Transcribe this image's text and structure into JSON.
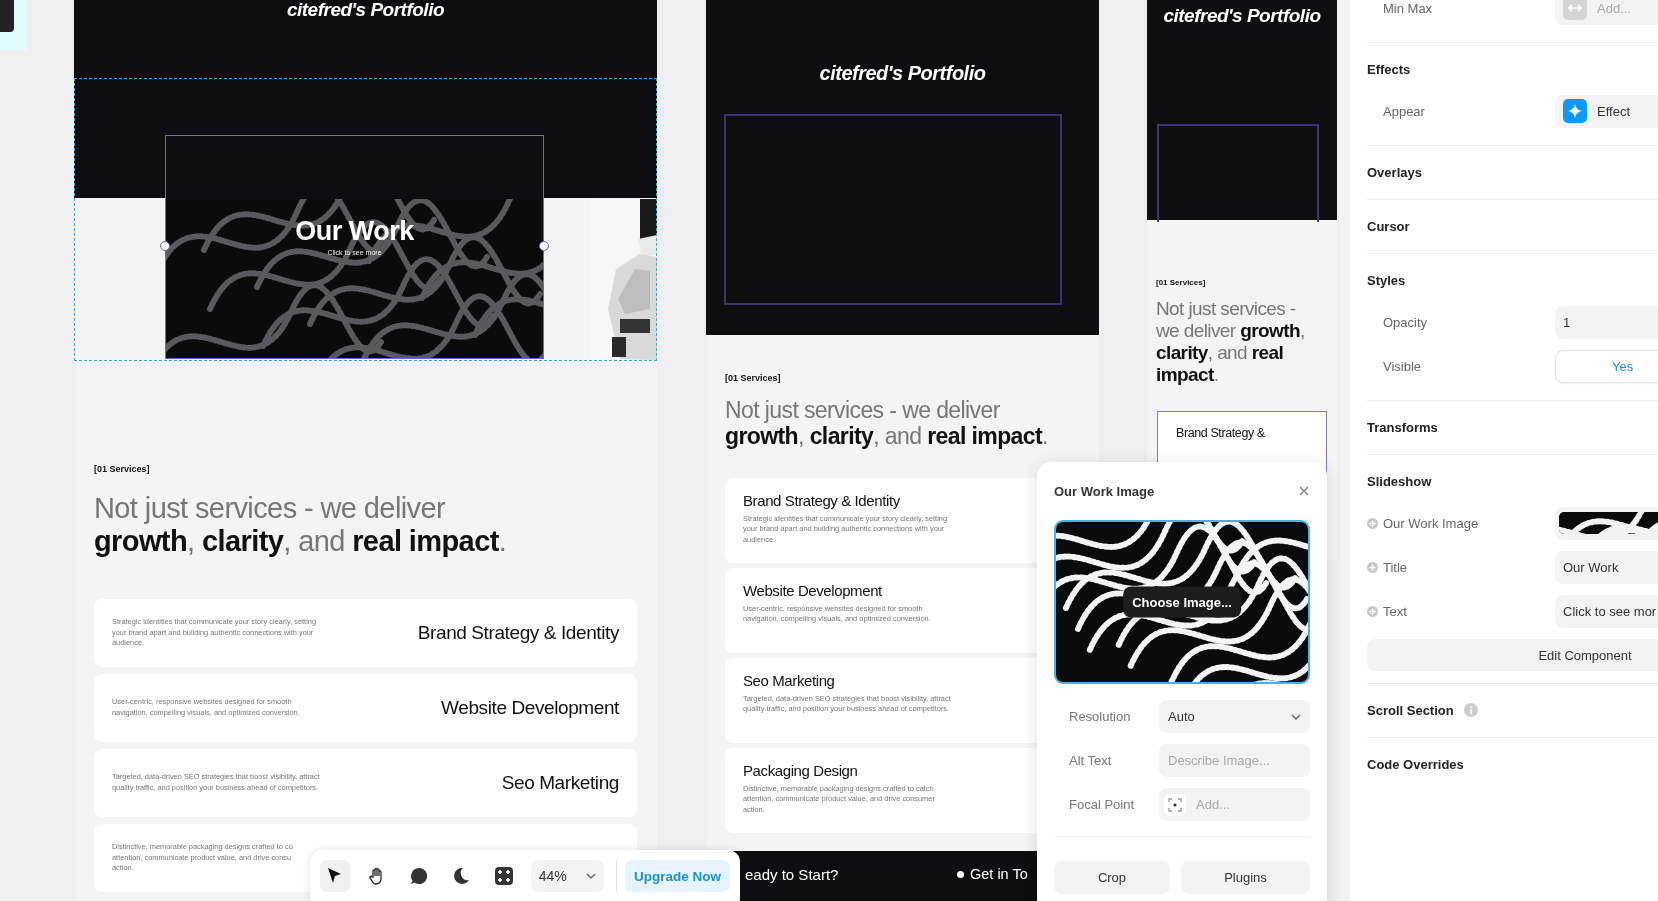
{
  "frames": [
    {
      "kind": "desktop",
      "site_title": "citefred's Portfolio",
      "hero": {
        "title": "Our Work",
        "text": "Click to see more",
        "selected": true
      },
      "services_label": "[01 Services]",
      "heading": "Not just services - we deliver **growth**, **clarity**, and **real impact**.",
      "cards": [
        {
          "title": "Brand Strategy & Identity",
          "text": "Strategic identities that communicate your story clearly, setting your brand apart and building authentic connections with your audience."
        },
        {
          "title": "Website Development",
          "text": "User-centric, responsive websites designed for smooth navigation, compelling visuals, and optimized conversion."
        },
        {
          "title": "Seo Marketing",
          "text": "Targeted, data-driven SEO strategies that boost visibility, attract quality traffic, and position your business ahead of competitors."
        },
        {
          "text": "Distinctive, memorable packaging designs crafted to co\nattention, communicate product value, and drive consu\naction."
        }
      ]
    },
    {
      "kind": "tablet",
      "site_title": "citefred's Portfolio",
      "services_label": "[01 Services]",
      "heading": "Not just services - we deliver **growth**, **clarity**, and **real impact**.",
      "cards": [
        {
          "title": "Brand Strategy & Identity",
          "text": "Strategic identities that communicate your story clearly, setting your brand apart and building authentic connections with your audience."
        },
        {
          "title": "Website Development",
          "text": "User-centric, responsive websites designed for smooth navigation, compelling visuals, and optimized conversion."
        },
        {
          "title": "Seo Marketing",
          "text": "Targeted, data-driven SEO strategies that boost visibility, attract quality traffic, and position your business ahead of competitors."
        },
        {
          "title": "Packaging Design",
          "text": "Distinctive, memorable packaging designs crafted to catch attention, communicate product value, and drive consumer action."
        }
      ],
      "footer": {
        "cta": "eady to Start?",
        "link": "Get in To"
      }
    },
    {
      "kind": "phone",
      "site_title": "citefred's Portfolio",
      "services_label": "[01 Services]",
      "heading": "Not just services - we deliver **growth**, **clarity**, and **real impact**.",
      "cards": [
        {
          "title": "Brand Strategy &",
          "selected": true
        }
      ]
    }
  ],
  "toolbar": {
    "tools": [
      {
        "kind": "pointer",
        "selected": true
      },
      {
        "kind": "hand",
        "selected": false
      },
      {
        "kind": "comment",
        "selected": false
      },
      {
        "kind": "moon",
        "selected": false
      },
      {
        "kind": "grid",
        "selected": false
      }
    ],
    "zoom": "44%",
    "upgrade": "Upgrade Now"
  },
  "popup": {
    "title": "Our Work Image",
    "image_button": "Choose Image...",
    "fields": [
      {
        "label": "Resolution",
        "kind": "select",
        "value": "Auto"
      },
      {
        "label": "Alt Text",
        "kind": "text",
        "placeholder": "Describe Image..."
      },
      {
        "label": "Focal Point",
        "kind": "focal",
        "placeholder": "Add..."
      }
    ],
    "buttons": [
      "Crop",
      "Plugins"
    ]
  },
  "properties": [
    {
      "kind": "rows",
      "rows": [
        {
          "label": "Min Max",
          "kind": "minmax",
          "placeholder": "Add..."
        }
      ]
    },
    {
      "kind": "section",
      "title": "Effects",
      "rows": [
        {
          "label": "Appear",
          "kind": "effect",
          "value": "Effect"
        }
      ]
    },
    {
      "kind": "section",
      "title": "Overlays"
    },
    {
      "kind": "section",
      "title": "Cursor"
    },
    {
      "kind": "section",
      "title": "Styles",
      "rows": [
        {
          "label": "Opacity",
          "kind": "text",
          "value": "1"
        },
        {
          "label": "Visible",
          "kind": "toggle",
          "value": "Yes"
        }
      ]
    },
    {
      "kind": "section",
      "title": "Transforms"
    },
    {
      "kind": "section",
      "title": "Slideshow",
      "rows": [
        {
          "label": "Our Work Image",
          "addable": true
        },
        {
          "label": "Title",
          "kind": "text",
          "value": "Our Work",
          "addable": true
        },
        {
          "label": "Text",
          "kind": "text",
          "value": "Click to see mor",
          "addable": true
        }
      ],
      "button": "Edit Component"
    },
    {
      "kind": "section",
      "title": "Scroll Section",
      "info": true
    },
    {
      "kind": "section",
      "title": "Code Overrides"
    }
  ]
}
